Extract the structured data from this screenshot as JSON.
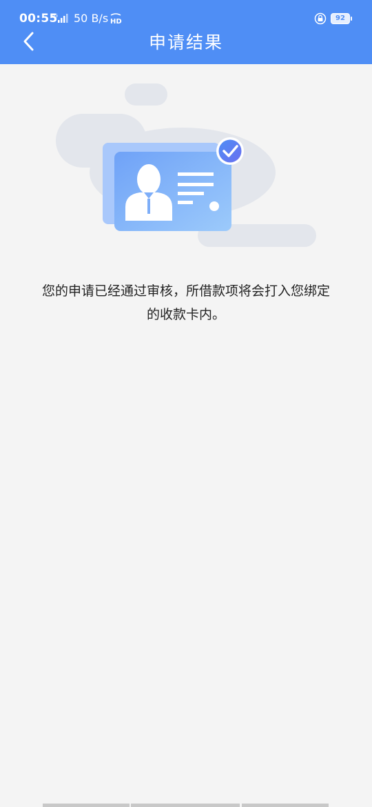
{
  "status_bar": {
    "time": "00:55",
    "net_speed": "50 B/s",
    "battery": "92",
    "icons": [
      "signal-4g-icon",
      "hd-icon",
      "lock-icon",
      "battery-icon"
    ]
  },
  "header": {
    "title": "申请结果",
    "back_icon": "chevron-left-icon",
    "background_color": "#4f8ef5"
  },
  "result": {
    "illustration": "id-card-approved-illustration",
    "message": "您的申请已经通过审核，所借款项将会打入您绑定的收款卡内。"
  }
}
